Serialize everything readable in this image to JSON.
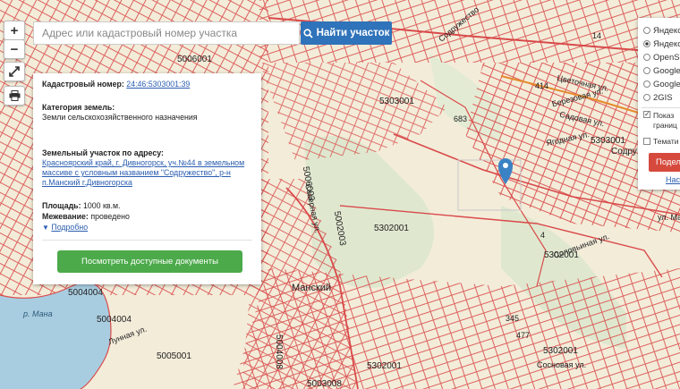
{
  "search": {
    "placeholder": "Адрес или кадастровый номер участка",
    "button_label": "Найти участок"
  },
  "zoom": {
    "in_label": "+",
    "out_label": "−"
  },
  "tools": {
    "fullscreen_icon": "expand-icon",
    "print_icon": "printer-icon"
  },
  "info_panel": {
    "cadastral_label": "Кадастровый номер:",
    "cadastral_value": "24:46:5303001:39",
    "category_label": "Категория земель:",
    "category_value": "Земли сельскохозяйственного назначения",
    "address_label": "Земельный участок по адресу:",
    "address_line1": "Красноярский край, г. Дивногорск, уч.№44 в земельном",
    "address_line2": "массиве с условным названием \"Содружество\", р-н",
    "address_line3": "п.Манский г.Дивногорска",
    "area_label": "Площадь:",
    "area_value": "1000 кв.м.",
    "survey_label": "Межевание:",
    "survey_value": "проведено",
    "details_label": "Подробно",
    "docs_button": "Посмотреть доступные документы"
  },
  "layers": {
    "options": [
      "Яндекс",
      "Яндекс",
      "OpenS",
      "Google",
      "Google",
      "2GIS"
    ],
    "selected_index": 1,
    "show_borders_label1": "Показ",
    "show_borders_label2": "границ",
    "thematic_label": "Темати",
    "share_button": "Подел",
    "footer_link": "Нас"
  },
  "map_labels": {
    "q1": "5006001",
    "q2": "5303001",
    "q3": "5303001",
    "q4": "5302001",
    "q5": "5302001",
    "q6": "5302001",
    "q7": "5302001",
    "q8": "5005001",
    "q9": "5004004",
    "q10": "5004004",
    "q11": "5003008",
    "q12": "5004008",
    "q13": "5002003",
    "q14": "5006003",
    "n683": "683",
    "n345": "345",
    "n477": "477",
    "n414": "414",
    "n14": "14",
    "n4": "4",
    "street1": "Цветочная ул.",
    "street2": "Березовая ул.",
    "street3": "Садовая ул.",
    "street4": "Ягодная ул.",
    "street5": "Содру",
    "street6": "ул. Ма",
    "street7": "Северная ул.",
    "street8": "Сосновая ул.",
    "street9": "Лунная ул.",
    "place1": "Манский",
    "river": "р. Мана",
    "street10": "Содружество",
    "street11": "Соловьиная ул."
  },
  "colors": {
    "parcel_line": "#d94a4a",
    "land": "#f3ecd9",
    "green": "#dfe8cf",
    "water": "#a9cde0",
    "accent": "#2f73ba",
    "marker": "#3b82c4"
  }
}
